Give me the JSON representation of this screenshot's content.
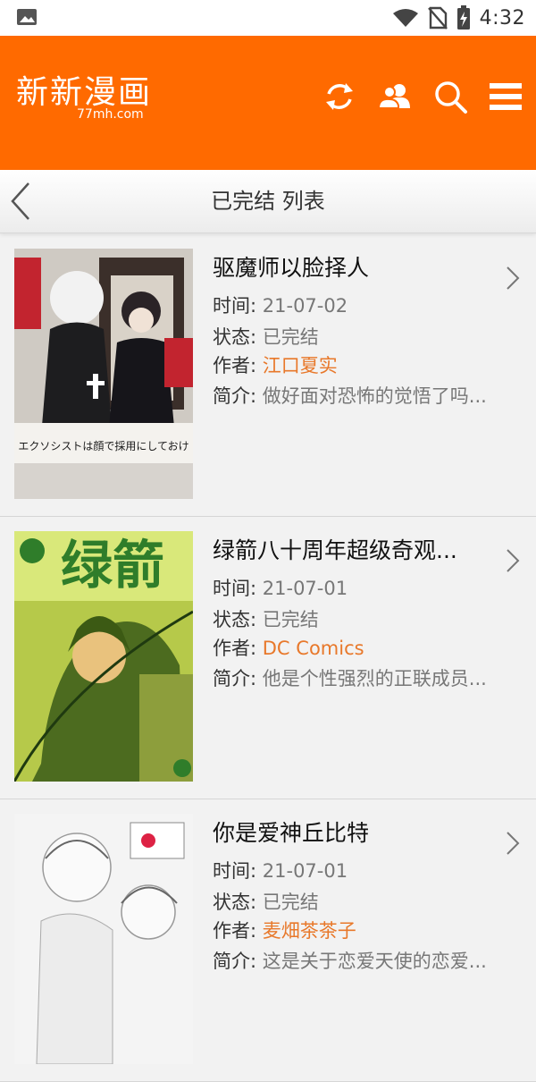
{
  "status_bar": {
    "time": "4:32",
    "icons": [
      "gallery-icon",
      "wifi-icon",
      "no-sim-icon",
      "battery-icon"
    ]
  },
  "app_bar": {
    "logo_title": "新新漫画",
    "logo_subtitle": "77mh.com",
    "background": "#ff6a00",
    "actions": [
      "refresh-icon",
      "user-icon",
      "search-icon",
      "menu-icon"
    ]
  },
  "sub_header": {
    "title": "已完结 列表",
    "back_icon": "back-chevron-icon"
  },
  "labels": {
    "time": "时间:",
    "status": "状态:",
    "author": "作者:",
    "intro": "简介:"
  },
  "items": [
    {
      "title": "驱魔师以脸择人",
      "time": "21-07-02",
      "status": "已完结",
      "author": "江口夏实",
      "intro": "做好面对恐怖的觉悟了吗...",
      "cover_text": "エクソシストは顔で採用にしておけ"
    },
    {
      "title": "绿箭八十周年超级奇观...",
      "time": "21-07-01",
      "status": "已完结",
      "author": "DC Comics",
      "intro": "他是个性强烈的正联成员...",
      "cover_text": "绿箭"
    },
    {
      "title": "你是爱神丘比特",
      "time": "21-07-01",
      "status": "已完结",
      "author": "麦畑茶茶子",
      "intro": "这是关于恋爱天使的恋爱...",
      "cover_text": ""
    }
  ],
  "colors": {
    "accent": "#ff6a00",
    "author_link": "#e8782a"
  }
}
